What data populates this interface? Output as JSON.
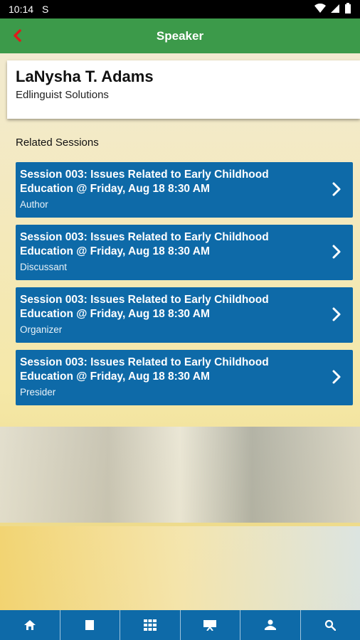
{
  "status": {
    "time": "10:14",
    "sim_label": "S"
  },
  "header": {
    "title": "Speaker",
    "back_icon": "chevron-left-icon"
  },
  "speaker": {
    "name": "LaNysha T. Adams",
    "organization": "Edlinguist Solutions"
  },
  "related": {
    "label": "Related Sessions",
    "sessions": [
      {
        "title": "Session 003: Issues Related to Early Childhood Education @ Friday, Aug 18 8:30 AM",
        "role": "Author"
      },
      {
        "title": "Session 003: Issues Related to Early Childhood Education @ Friday, Aug 18 8:30 AM",
        "role": "Discussant"
      },
      {
        "title": "Session 003: Issues Related to Early Childhood Education @ Friday, Aug 18 8:30 AM",
        "role": "Organizer"
      },
      {
        "title": "Session 003: Issues Related to Early Childhood Education @ Friday, Aug 18 8:30 AM",
        "role": "Presider"
      }
    ]
  },
  "bottom_nav": [
    "home-icon",
    "book-icon",
    "grid-icon",
    "presentation-icon",
    "people-icon",
    "search-icon"
  ],
  "colors": {
    "header_green": "#3c9a4a",
    "session_blue": "#0e6aa8",
    "back_red": "#e01b1b"
  }
}
